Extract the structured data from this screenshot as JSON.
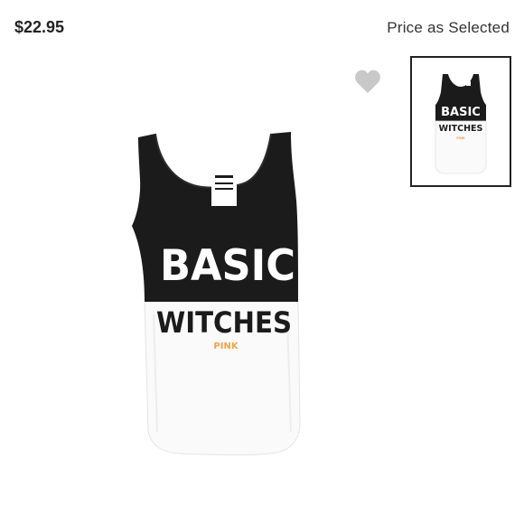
{
  "product": {
    "price": "$22.95",
    "price_note": "Price as Selected",
    "graphic": {
      "line1": "BASIC",
      "line2": "WITCHES",
      "brand": "PINK"
    }
  },
  "icons": {
    "favorite": "heart-icon"
  },
  "colors": {
    "tank_top": "#1b1b1b",
    "tank_bottom": "#fafafa",
    "heart": "#c8c8c8",
    "brand_accent": "#f4a347",
    "thumb_border": "#222222"
  }
}
